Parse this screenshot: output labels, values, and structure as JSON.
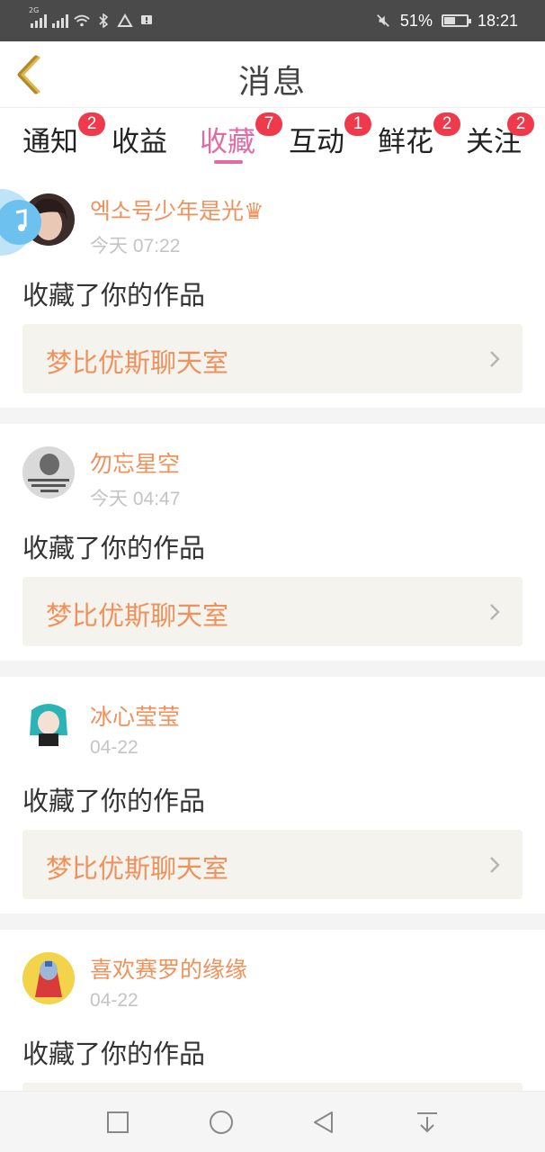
{
  "status_bar": {
    "network_label": "2G",
    "battery_percent": "51%",
    "battery_level": 0.51,
    "time": "18:21"
  },
  "header": {
    "title": "消息"
  },
  "tabs": [
    {
      "label": "通知",
      "badge": "2"
    },
    {
      "label": "收益",
      "badge": ""
    },
    {
      "label": "收藏",
      "badge": "7",
      "active": true
    },
    {
      "label": "互动",
      "badge": "1"
    },
    {
      "label": "鲜花",
      "badge": "2"
    },
    {
      "label": "关注",
      "badge": "2"
    }
  ],
  "items": [
    {
      "user": "엑소号少年是光♛",
      "time": "今天 07:22",
      "action": "收藏了你的作品",
      "work": "梦比优斯聊天室"
    },
    {
      "user": "勿忘星空",
      "time": "今天 04:47",
      "action": "收藏了你的作品",
      "work": "梦比优斯聊天室"
    },
    {
      "user": "冰心莹莹",
      "time": "04-22",
      "action": "收藏了你的作品",
      "work": "梦比优斯聊天室"
    },
    {
      "user": "喜欢赛罗的缘缘",
      "time": "04-22",
      "action": "收藏了你的作品",
      "work": ""
    }
  ],
  "colors": {
    "accent_pink": "#e26aa4",
    "username_orange": "#f0915b",
    "badge_red": "#f0394a",
    "work_card_bg": "#f4f3ed"
  },
  "icons": {
    "back": "back-chevron-icon",
    "music": "music-note-icon",
    "link": "chevron-right-icon",
    "nav": [
      "square-recents-icon",
      "circle-home-icon",
      "triangle-back-icon",
      "pull-down-icon"
    ]
  }
}
